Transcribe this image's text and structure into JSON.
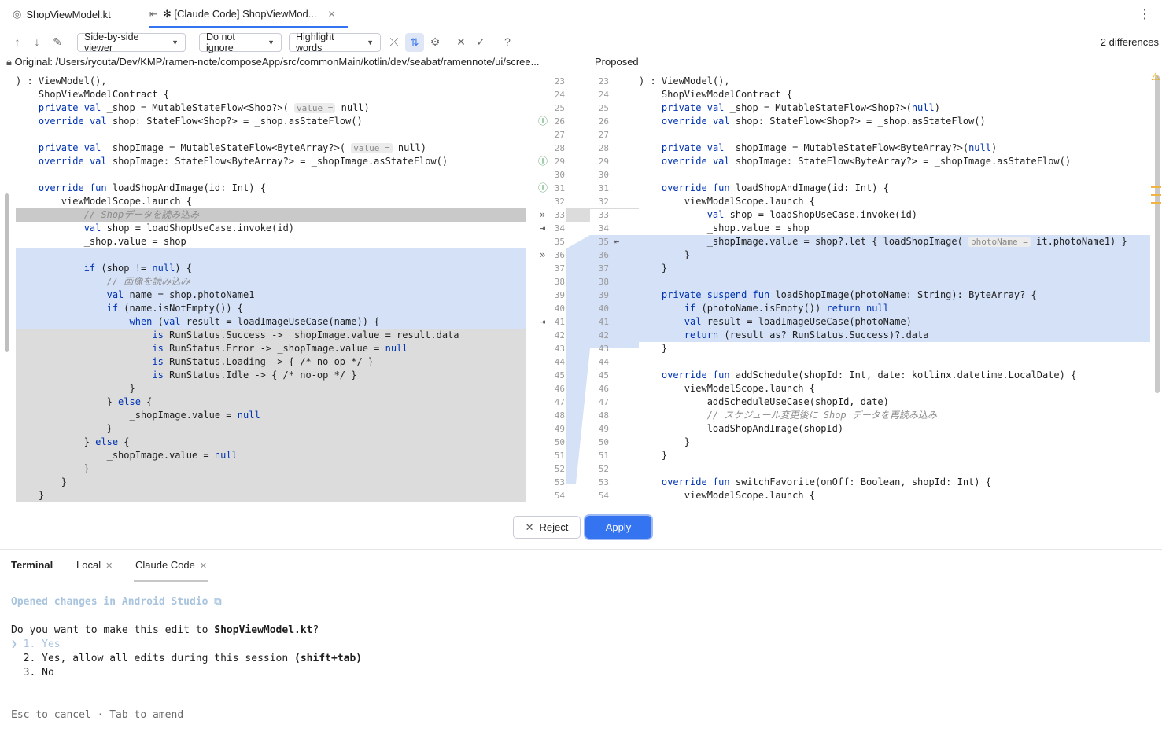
{
  "tabs": [
    {
      "icon": "kotlin-file-icon",
      "label": "ShopViewModel.kt"
    },
    {
      "icon": "diff-icon",
      "label": "✻ [Claude Code] ShopViewMod...",
      "active": true
    }
  ],
  "toolbar": {
    "viewer": "Side-by-side viewer",
    "ignore": "Do not ignore",
    "highlight": "Highlight words",
    "differences": "2 differences"
  },
  "header": {
    "left": "Original: /Users/ryouta/Dev/KMP/ramen-note/composeApp/src/commonMain/kotlin/dev/seabat/ramennote/ui/scree...",
    "right": "Proposed"
  },
  "left_lines": [
    ") : ViewModel(),",
    "    ShopViewModelContract {",
    "    private val _shop = MutableStateFlow<Shop?>(",
    "    override val shop: StateFlow<Shop?> = _shop.asStateFlow()",
    "",
    "    private val _shopImage = MutableStateFlow<ByteArray?>(",
    "    override val shopImage: StateFlow<ByteArray?> = _shopImage.asStateFlow()",
    "",
    "    override fun loadShopAndImage(id: Int) {",
    "        viewModelScope.launch {",
    "            // Shopデータを読み込み",
    "            val shop = loadShopUseCase.invoke(id)",
    "            _shop.value = shop",
    "",
    "            if (shop != null) {",
    "                // 画像を読み込み",
    "                val name = shop.photoName1",
    "                if (name.isNotEmpty()) {",
    "                    when (val result = loadImageUseCase(name)) {",
    "                        is RunStatus.Success -> _shopImage.value = result.data",
    "                        is RunStatus.Error -> _shopImage.value = null",
    "                        is RunStatus.Loading -> { /* no-op */ }",
    "                        is RunStatus.Idle -> { /* no-op */ }",
    "                    }",
    "                } else {",
    "                    _shopImage.value = null",
    "                }",
    "            } else {",
    "                _shopImage.value = null",
    "            }",
    "        }",
    "    }"
  ],
  "left_hints": {
    "value": "value =",
    "null": "null)"
  },
  "right_lines": [
    ") : ViewModel(),",
    "    ShopViewModelContract {",
    "    private val _shop = MutableStateFlow<Shop?>(null)",
    "    override val shop: StateFlow<Shop?> = _shop.asStateFlow()",
    "",
    "    private val _shopImage = MutableStateFlow<ByteArray?>(null)",
    "    override val shopImage: StateFlow<ByteArray?> = _shopImage.asStateFlow()",
    "",
    "    override fun loadShopAndImage(id: Int) {",
    "        viewModelScope.launch {",
    "            val shop = loadShopUseCase.invoke(id)",
    "            _shop.value = shop",
    "            _shopImage.value = shop?.let { loadShopImage(",
    "        }",
    "    }",
    "",
    "    private suspend fun loadShopImage(photoName: String): ByteArray? {",
    "        if (photoName.isEmpty()) return null",
    "        val result = loadImageUseCase(photoName)",
    "        return (result as? RunStatus.Success)?.data",
    "    }",
    "",
    "    override fun addSchedule(shopId: Int, date: kotlinx.datetime.LocalDate) {",
    "        viewModelScope.launch {",
    "            addScheduleUseCase(shopId, date)",
    "            // スケジュール変更後に Shop データを再読み込み",
    "            loadShopAndImage(shopId)",
    "        }",
    "    }",
    "",
    "    override fun switchFavorite(onOff: Boolean, shopId: Int) {",
    "        viewModelScope.launch {"
  ],
  "right_hint": "photoName =",
  "right_hint_tail": "it.photoName1) }",
  "left_gutter": [
    "23",
    "24",
    "25",
    "26",
    "27",
    "28",
    "29",
    "30",
    "31",
    "32",
    "33",
    "34",
    "35",
    "36",
    "37",
    "38",
    "39",
    "40",
    "41",
    "42",
    "43",
    "44",
    "45",
    "46",
    "47",
    "48",
    "49",
    "50",
    "51",
    "52",
    "53",
    "54"
  ],
  "right_gutter": [
    "23",
    "24",
    "25",
    "26",
    "27",
    "28",
    "29",
    "30",
    "31",
    "32",
    "33",
    "34",
    "35",
    "36",
    "37",
    "38",
    "39",
    "40",
    "41",
    "42",
    "43",
    "44",
    "45",
    "46",
    "47",
    "48",
    "49",
    "50",
    "51",
    "52",
    "53",
    "54"
  ],
  "buttons": {
    "reject": "Reject",
    "apply": "Apply"
  },
  "terminal": {
    "tabs": [
      "Terminal",
      "Local",
      "Claude Code"
    ],
    "opened": "Opened changes in Android Studio ⧉",
    "question_prefix": "Do you want to make this edit to ",
    "question_file": "ShopViewModel.kt",
    "question_suffix": "?",
    "opt1": "❯ 1. Yes",
    "opt2": "  2. Yes, allow all edits during this session ",
    "opt2_bold": "(shift+tab)",
    "opt3": "  3. No",
    "footer": "Esc to cancel · Tab to amend"
  }
}
